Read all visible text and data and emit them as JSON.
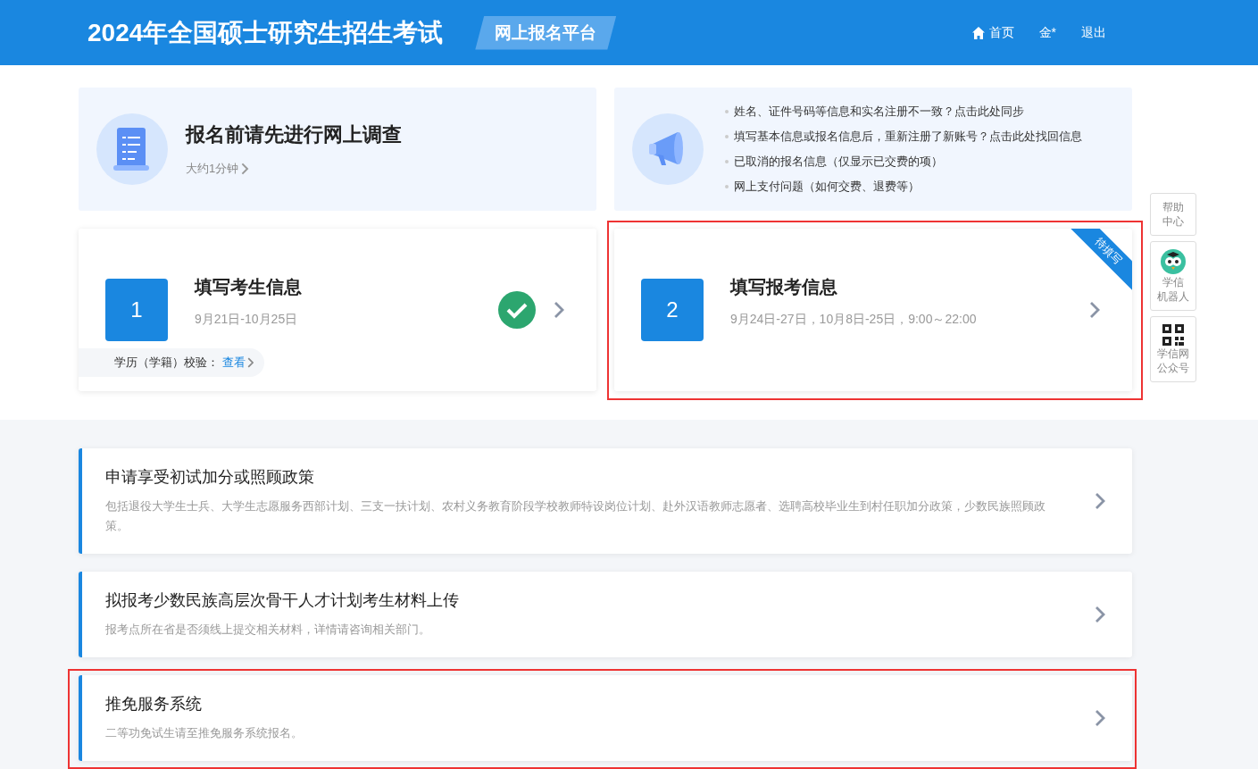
{
  "header": {
    "title": "2024年全国硕士研究生招生考试",
    "platform": "网上报名平台",
    "nav": [
      {
        "kind": "home",
        "label": "首页"
      },
      {
        "kind": "text",
        "label": "金*"
      },
      {
        "kind": "text",
        "label": "退出"
      }
    ]
  },
  "survey": {
    "title": "报名前请先进行网上调查",
    "subtitle": "大约1分钟"
  },
  "notices": [
    "姓名、证件号码等信息和实名注册不一致？点击此处同步",
    "填写基本信息或报名信息后，重新注册了新账号？点击此处找回信息",
    "已取消的报名信息（仅显示已交费的项）",
    "网上支付问题（如何交费、退费等）"
  ],
  "steps": [
    {
      "number": "1",
      "title": "填写考生信息",
      "dates": "9月21日-10月25日",
      "done": true,
      "highlighted": false,
      "note": {
        "label": "学历（学籍）校验：",
        "link": "查看"
      }
    },
    {
      "number": "2",
      "title": "填写报考信息",
      "dates": "9月24日-27日，10月8日-25日，9:00～22:00",
      "done": false,
      "highlighted": true,
      "badge": "待填写"
    }
  ],
  "services": [
    {
      "title": "申请享受初试加分或照顾政策",
      "desc": "包括退役大学生士兵、大学生志愿服务西部计划、三支一扶计划、农村义务教育阶段学校教师特设岗位计划、赴外汉语教师志愿者、选聘高校毕业生到村任职加分政策，少数民族照顾政策。",
      "highlighted": false
    },
    {
      "title": "拟报考少数民族高层次骨干人才计划考生材料上传",
      "desc": "报考点所在省是否须线上提交相关材料，详情请咨询相关部门。",
      "highlighted": false
    },
    {
      "title": "推免服务系统",
      "desc": "二等功免试生请至推免服务系统报名。",
      "highlighted": true
    }
  ],
  "side_tools": [
    {
      "kind": "text",
      "lines": [
        "帮助",
        "中心"
      ]
    },
    {
      "kind": "robot",
      "lines": [
        "学信",
        "机器人"
      ]
    },
    {
      "kind": "qr",
      "lines": [
        "学信网",
        "公众号"
      ]
    }
  ]
}
